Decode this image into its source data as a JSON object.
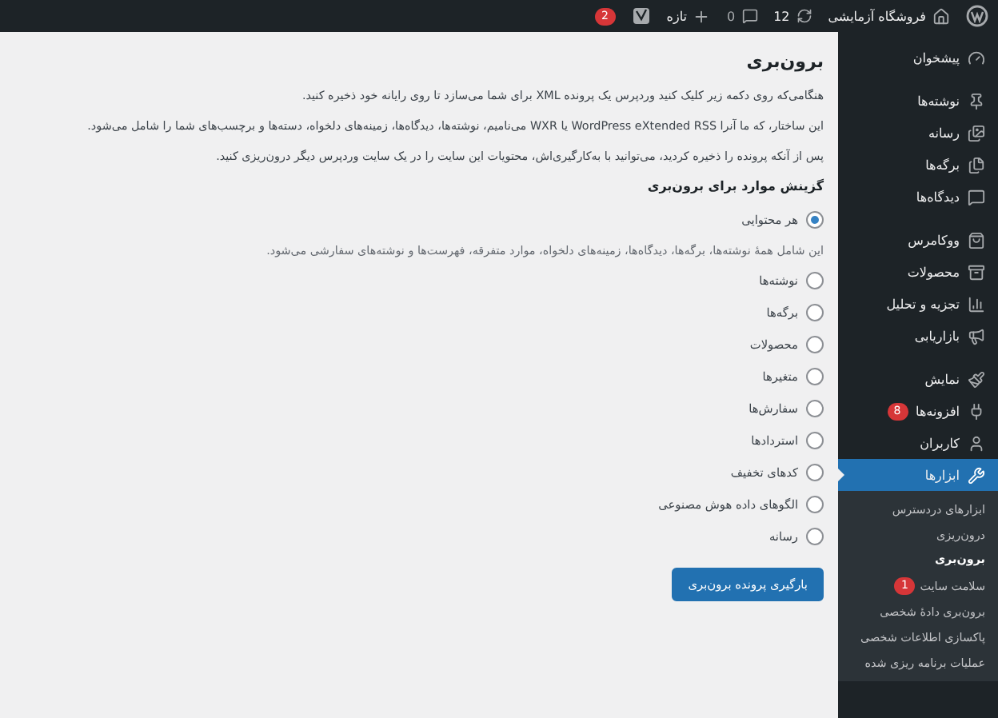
{
  "admin_bar": {
    "site_name": "فروشگاه آزمایشی",
    "updates": "12",
    "comments": "0",
    "new_label": "تازه",
    "notification_badge": "2"
  },
  "sidebar": {
    "groups": [
      [
        {
          "label": "پیشخوان",
          "selected": false
        }
      ],
      [
        {
          "label": "نوشته‌ها",
          "selected": false
        },
        {
          "label": "رسانه",
          "selected": false
        },
        {
          "label": "برگه‌ها",
          "selected": false
        },
        {
          "label": "دیدگاه‌ها",
          "selected": false
        }
      ],
      [
        {
          "label": "ووکامرس",
          "selected": false
        },
        {
          "label": "محصولات",
          "selected": false
        },
        {
          "label": "تجزیه و تحلیل",
          "selected": false
        },
        {
          "label": "بازاریابی",
          "selected": false
        }
      ],
      [
        {
          "label": "نمایش",
          "selected": false
        },
        {
          "label": "افزونه‌ها",
          "selected": false,
          "badge": "8"
        },
        {
          "label": "کاربران",
          "selected": false
        },
        {
          "label": "ابزارها",
          "selected": true,
          "children": [
            {
              "label": "ابزارهای دردسترس",
              "selected": false
            },
            {
              "label": "درون‌ریزی",
              "selected": false
            },
            {
              "label": "برون‌بری",
              "selected": true
            },
            {
              "label": "سلامت سایت",
              "selected": false,
              "badge": "1"
            },
            {
              "label": "برون‌بری دادهٔ شخصی",
              "selected": false
            },
            {
              "label": "پاکسازی اطلاعات شخصی",
              "selected": false
            },
            {
              "label": "عملیات برنامه ریزی شده",
              "selected": false
            }
          ]
        }
      ]
    ]
  },
  "page": {
    "title": "برون‌بری",
    "paragraphs": [
      "هنگامی‌که روی دکمه زیر کلیک کنید وردپرس یک پرونده XML برای شما می‌سازد تا روی رایانه خود ذخیره کنید.",
      "این ساختار، که ما آنرا WordPress eXtended RSS یا WXR می‌نامیم، نوشته‌ها، دیدگاه‌ها، زمینه‌های دلخواه، دسته‌ها و برچسب‌های شما را شامل می‌شود.",
      "پس از آنکه پرونده را ذخیره کردید، می‌توانید با به‌کارگیری‌اش، محتویات این سایت را در یک سایت وردپرس دیگر درون‌ریزی کنید."
    ],
    "section_heading": "گزینش موارد برای برون‌بری",
    "options": [
      {
        "label": "هر محتوایی",
        "selected": true,
        "description": "این شامل همهٔ نوشته‌ها، برگه‌ها، دیدگاه‌ها، زمینه‌های دلخواه، موارد متفرقه، فهرست‌ها و نوشته‌های سفارشی می‌شود."
      },
      {
        "label": "نوشته‌ها",
        "selected": false
      },
      {
        "label": "برگه‌ها",
        "selected": false
      },
      {
        "label": "محصولات",
        "selected": false
      },
      {
        "label": "متغیرها",
        "selected": false
      },
      {
        "label": "سفارش‌ها",
        "selected": false
      },
      {
        "label": "استردادها",
        "selected": false
      },
      {
        "label": "کدهای تخفیف",
        "selected": false
      },
      {
        "label": "الگوهای داده هوش مصنوعی",
        "selected": false
      },
      {
        "label": "رسانه",
        "selected": false
      }
    ],
    "submit_button": "بارگیری پرونده برون‌بری"
  }
}
